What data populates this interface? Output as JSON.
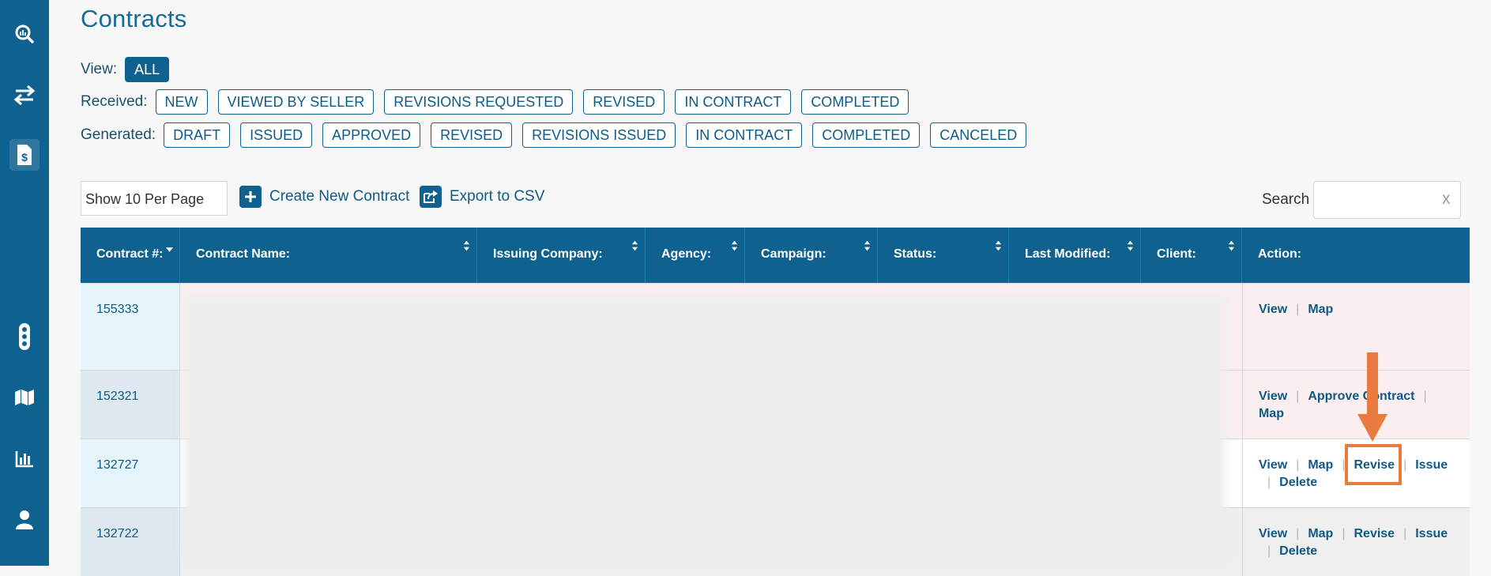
{
  "page": {
    "title": "Contracts"
  },
  "filters": {
    "view": {
      "label": "View:",
      "chips": [
        "ALL"
      ]
    },
    "received": {
      "label": "Received:",
      "chips": [
        "NEW",
        "VIEWED BY SELLER",
        "REVISIONS REQUESTED",
        "REVISED",
        "IN CONTRACT",
        "COMPLETED"
      ]
    },
    "generated": {
      "label": "Generated:",
      "chips": [
        "DRAFT",
        "ISSUED",
        "APPROVED",
        "REVISED",
        "REVISIONS ISSUED",
        "IN CONTRACT",
        "COMPLETED",
        "CANCELED"
      ]
    }
  },
  "toolbar": {
    "per_page": "Show 10 Per Page",
    "create_label": "Create New Contract",
    "export_label": "Export to CSV",
    "search_label": "Search",
    "search_value": "",
    "search_clear": "x"
  },
  "table": {
    "columns": [
      "Contract #:",
      "Contract Name:",
      "Issuing Company:",
      "Agency:",
      "Campaign:",
      "Status:",
      "Last Modified:",
      "Client:",
      "Action:"
    ],
    "rows": [
      {
        "id": "155333",
        "actions": [
          "View",
          "Map"
        ]
      },
      {
        "id": "152321",
        "actions": [
          "View",
          "Approve Contract",
          "Map"
        ]
      },
      {
        "id": "132727",
        "actions": [
          "View",
          "Map",
          "Revise",
          "Issue",
          "Delete"
        ]
      },
      {
        "id": "132722",
        "actions": [
          "View",
          "Map",
          "Revise",
          "Issue",
          "Delete"
        ]
      }
    ]
  },
  "colors": {
    "primary": "#0f6290",
    "highlight": "#ea7b3f",
    "row_pink": "#fbeeee",
    "row_white": "#ffffff",
    "row_gray": "#efefef",
    "id_cell_blue": "#e6f4fb"
  },
  "icons": {
    "sidebar": [
      "search-chart-icon",
      "transfer-arrows-icon",
      "contract-dollar-icon",
      "traffic-light-icon",
      "map-icon",
      "bar-chart-icon",
      "user-icon"
    ],
    "toolbar": [
      "plus-icon",
      "export-icon"
    ],
    "annotation": "down-arrow"
  }
}
